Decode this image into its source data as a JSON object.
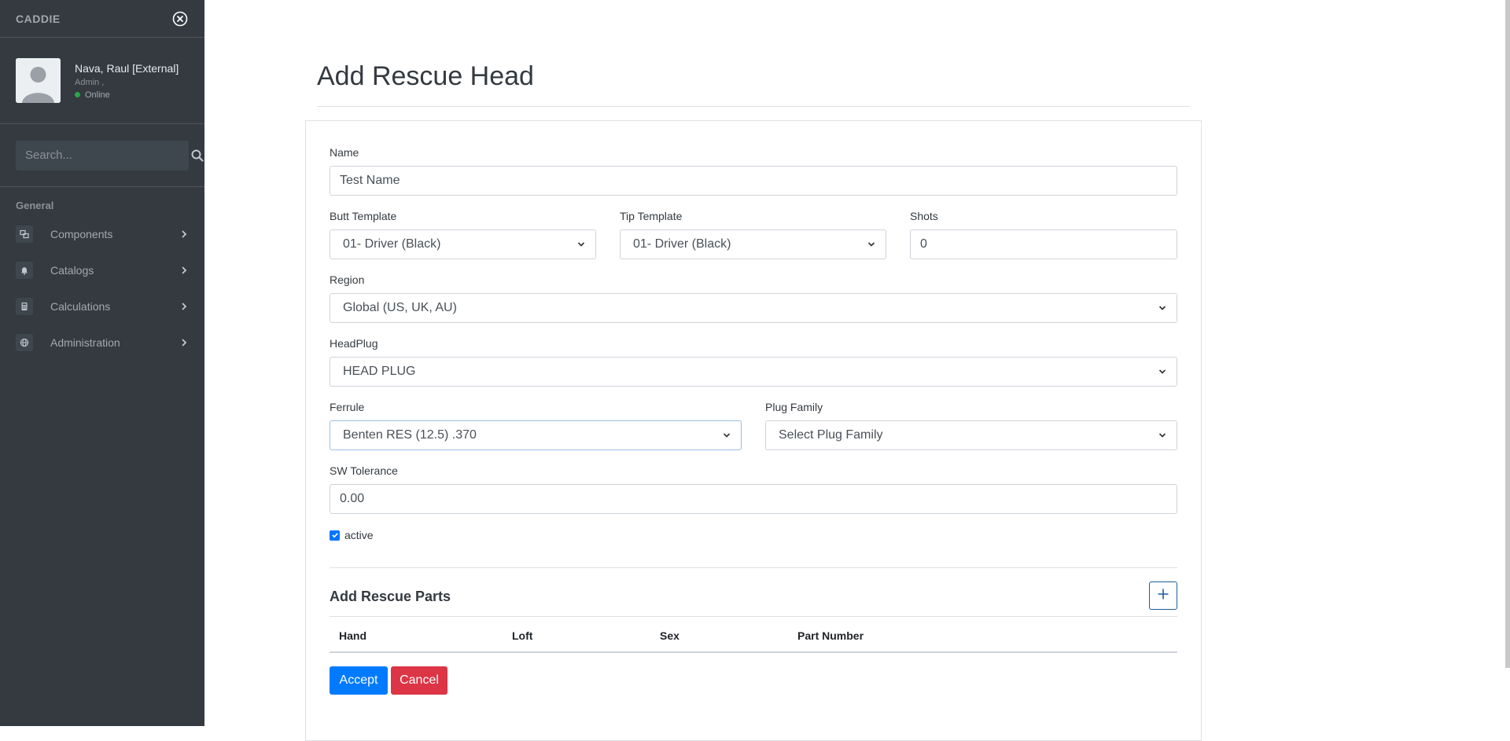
{
  "sidebar": {
    "brand": "CADDIE",
    "user": {
      "name": "Nava, Raul [External]",
      "role": "Admin ,",
      "status": "Online"
    },
    "search": {
      "placeholder": "Search..."
    },
    "nav_header": "General",
    "items": [
      {
        "label": "Components",
        "icon": "components-icon"
      },
      {
        "label": "Catalogs",
        "icon": "bell-icon"
      },
      {
        "label": "Calculations",
        "icon": "calculator-icon"
      },
      {
        "label": "Administration",
        "icon": "globe-icon"
      }
    ]
  },
  "page": {
    "title": "Add Rescue Head"
  },
  "form": {
    "name": {
      "label": "Name",
      "value": "Test Name"
    },
    "butt_template": {
      "label": "Butt Template",
      "value": "01- Driver (Black)"
    },
    "tip_template": {
      "label": "Tip Template",
      "value": "01- Driver (Black)"
    },
    "shots": {
      "label": "Shots",
      "value": "0"
    },
    "region": {
      "label": "Region",
      "value": "Global (US, UK, AU)"
    },
    "headplug": {
      "label": "HeadPlug",
      "value": "HEAD PLUG"
    },
    "ferrule": {
      "label": "Ferrule",
      "value": "Benten RES (12.5) .370"
    },
    "plug_family": {
      "label": "Plug Family",
      "value": "Select Plug Family"
    },
    "sw_tolerance": {
      "label": "SW Tolerance",
      "value": "0.00"
    },
    "active": {
      "label": "active",
      "checked": true
    }
  },
  "parts": {
    "title": "Add Rescue Parts",
    "columns": [
      "Hand",
      "Loft",
      "Sex",
      "Part Number"
    ]
  },
  "actions": {
    "accept": "Accept",
    "cancel": "Cancel"
  },
  "colors": {
    "sidebar_bg": "#343a40",
    "primary": "#007bff",
    "danger": "#dc3545",
    "online": "#28a745"
  }
}
